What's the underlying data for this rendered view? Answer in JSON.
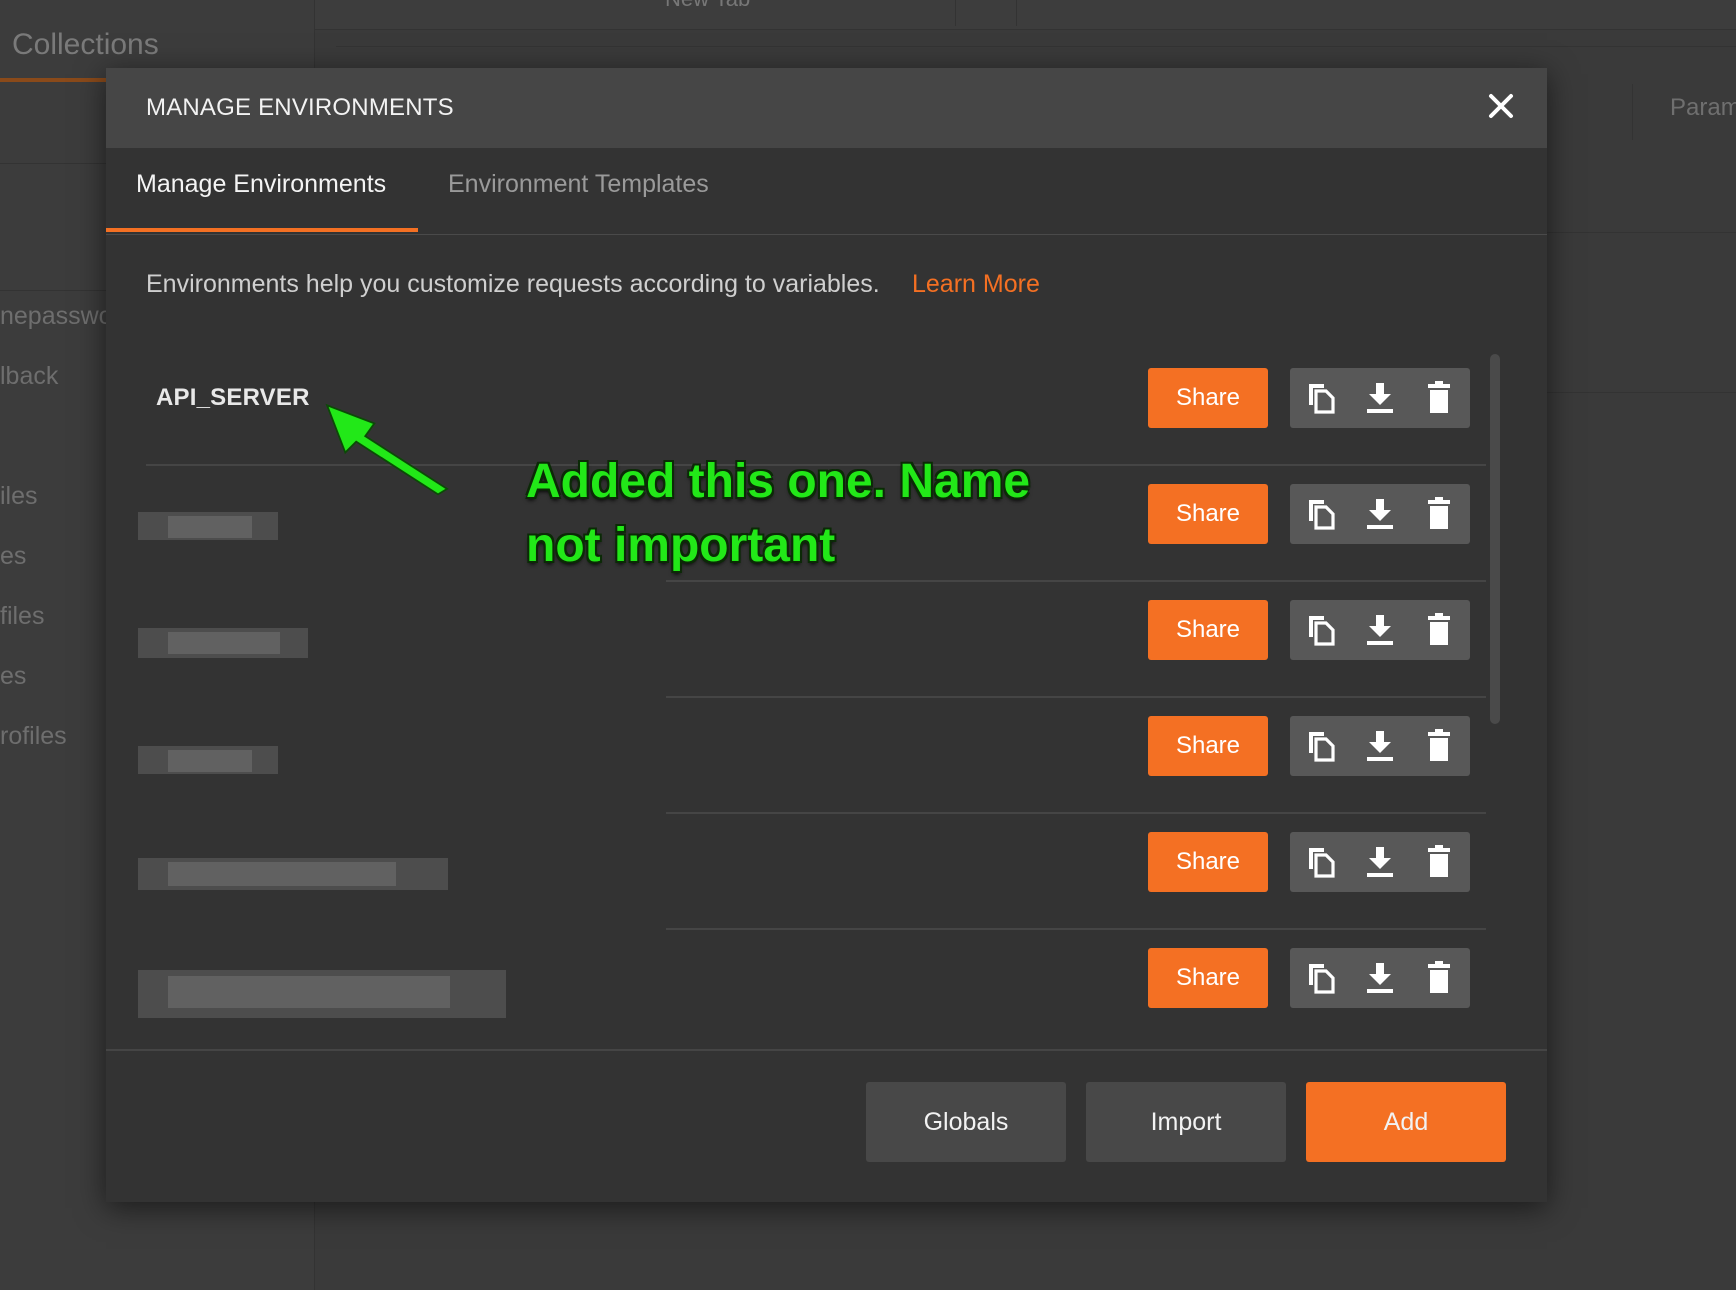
{
  "background": {
    "tab_label": "New Tab",
    "sidebar_title": "Collections",
    "sidebar_items": [
      "nepasswo",
      "lback",
      "iles",
      "es",
      "files",
      "es",
      "rofiles"
    ],
    "params_label": "Param"
  },
  "modal": {
    "title": "MANAGE ENVIRONMENTS",
    "close_icon": "close-icon",
    "tabs": [
      {
        "label": "Manage Environments",
        "active": true
      },
      {
        "label": "Environment Templates",
        "active": false
      }
    ],
    "intro_text": "Environments help you customize requests according to variables.",
    "learn_more": "Learn More",
    "environments": [
      {
        "name": "API_SERVER",
        "share": "Share"
      },
      {
        "name": "",
        "share": "Share"
      },
      {
        "name": "",
        "share": "Share"
      },
      {
        "name": "",
        "share": "Share"
      },
      {
        "name": "",
        "share": "Share"
      },
      {
        "name": "",
        "share": "Share"
      }
    ],
    "row_icons": [
      "duplicate-icon",
      "download-icon",
      "delete-icon"
    ],
    "footer": {
      "globals": "Globals",
      "import": "Import",
      "add": "Add"
    }
  },
  "annotation": {
    "text_line1": "Added this one. Name",
    "text_line2": "not important"
  },
  "colors": {
    "accent": "#f47023",
    "modal_bg": "#333333",
    "header_bg": "#464646",
    "annotation": "#22e818"
  }
}
